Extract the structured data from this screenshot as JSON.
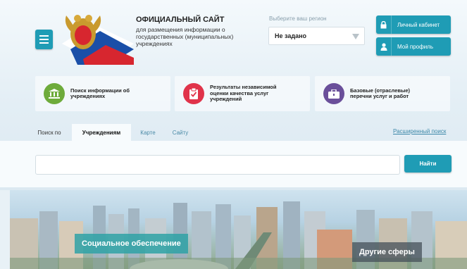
{
  "header": {
    "title": "ОФИЦИАЛЬНЫЙ САЙТ",
    "subtitle": "для размещения информации о государственных (муниципальных) учреждениях",
    "region_label": "Выберите ваш регион",
    "region_value": "Не задано",
    "cabinet_label": "Личный кабинет",
    "profile_label": "Мой профиль"
  },
  "cards": [
    {
      "label": "Поиск информации об учреждениях",
      "icon": "building-icon",
      "color": "#6eab3b"
    },
    {
      "label": "Результаты независимой оценки качества услуг учреждений",
      "icon": "checklist-icon",
      "color": "#e0334a"
    },
    {
      "label": "Базовые (отраслевые) перечни услуг и работ",
      "icon": "briefcase-icon",
      "color": "#6a4f9a"
    }
  ],
  "search": {
    "prefix": "Поиск по",
    "tabs": [
      "Учреждениям",
      "Карте",
      "Сайту"
    ],
    "advanced_link": "Расширенный поиск",
    "input_value": "",
    "button_label": "Найти"
  },
  "banner": {
    "label_left": "Социальное обеспечение",
    "label_right": "Другие сферы"
  },
  "colors": {
    "accent": "#1f9cb5"
  }
}
